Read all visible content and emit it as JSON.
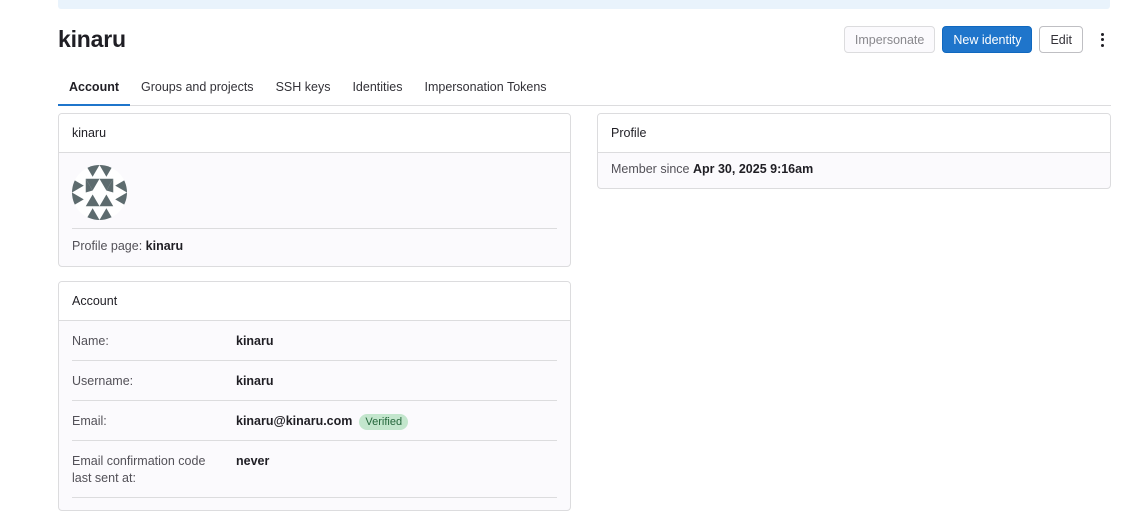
{
  "header": {
    "title": "kinaru",
    "impersonate_label": "Impersonate",
    "new_identity_label": "New identity",
    "edit_label": "Edit"
  },
  "tabs": [
    {
      "label": "Account",
      "active": true
    },
    {
      "label": "Groups and projects"
    },
    {
      "label": "SSH keys"
    },
    {
      "label": "Identities"
    },
    {
      "label": "Impersonation Tokens"
    }
  ],
  "user_card": {
    "title": "kinaru",
    "profile_page_label": "Profile page:",
    "profile_page_value": "kinaru"
  },
  "account_card": {
    "title": "Account",
    "rows": [
      {
        "label": "Name:",
        "value": "kinaru"
      },
      {
        "label": "Username:",
        "value": "kinaru"
      },
      {
        "label": "Email:",
        "value": "kinaru@kinaru.com",
        "badge": "Verified"
      },
      {
        "label": "Email confirmation code last sent at:",
        "value": "never"
      }
    ]
  },
  "profile_card": {
    "title": "Profile",
    "member_since_label": "Member since",
    "member_since_value": "Apr 30, 2025 9:16am"
  },
  "colors": {
    "primary": "#1f75cb",
    "badge_bg": "#c3e6cd",
    "badge_text": "#24663b",
    "avatar": "#5d6b6e"
  }
}
